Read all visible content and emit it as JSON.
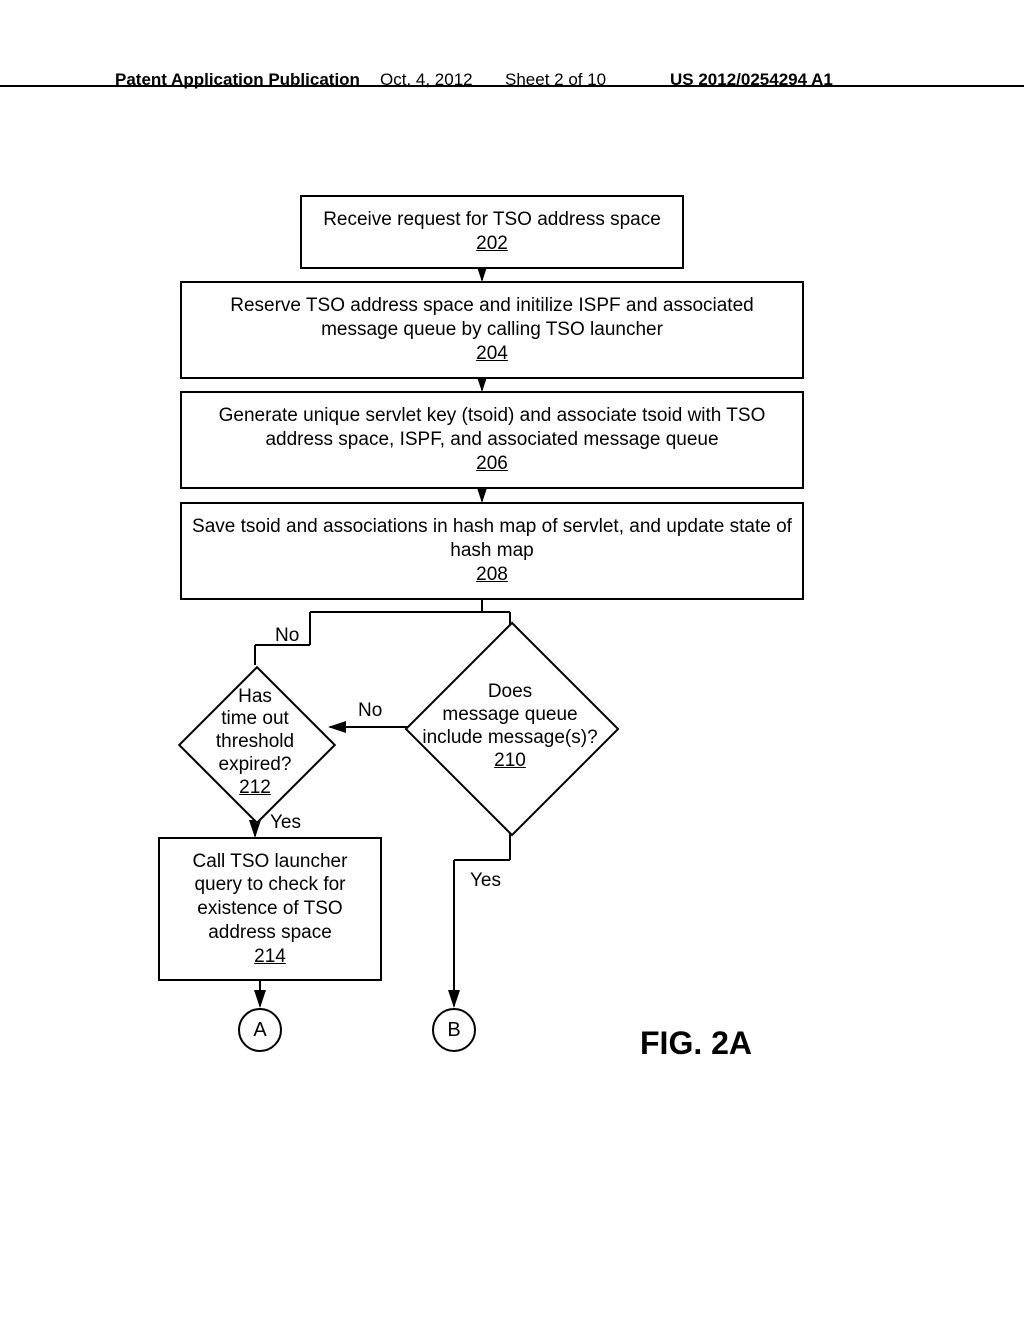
{
  "header": {
    "left": "Patent Application Publication",
    "date": "Oct. 4, 2012",
    "sheet": "Sheet 2 of 10",
    "pubnum": "US 2012/0254294 A1"
  },
  "boxes": {
    "b202": {
      "text": "Receive request for TSO address space",
      "ref": "202"
    },
    "b204": {
      "text": "Reserve TSO address space and initilize ISPF and associated message queue by calling TSO launcher",
      "ref": "204"
    },
    "b206": {
      "text": "Generate unique servlet key (tsoid) and associate tsoid with TSO address space, ISPF, and associated message queue",
      "ref": "206"
    },
    "b208": {
      "text": "Save tsoid and associations in hash map of servlet, and update state of hash map",
      "ref": "208"
    },
    "b214": {
      "text": "Call TSO launcher query to check for existence of TSO address space",
      "ref": "214"
    }
  },
  "diamonds": {
    "d210": {
      "l1": "Does",
      "l2": "message queue",
      "l3": "include message(s)?",
      "ref": "210"
    },
    "d212": {
      "l1": "Has",
      "l2": "time out",
      "l3": "threshold",
      "l4": "expired?",
      "ref": "212"
    }
  },
  "edges": {
    "no1": "No",
    "no2": "No",
    "yes1": "Yes",
    "yes2": "Yes"
  },
  "connectors": {
    "a": "A",
    "b": "B"
  },
  "figure": "FIG. 2A"
}
